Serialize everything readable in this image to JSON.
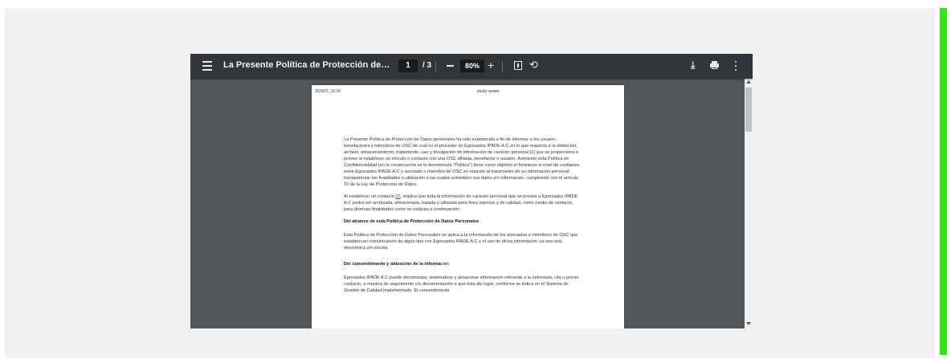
{
  "toolbar": {
    "menu_icon": "hamburger-menu-icon",
    "title": "La Presente Política de Protección de Datos person...",
    "current_page": "1",
    "page_total": "/  3",
    "zoom": "80%",
    "zoom_minus": "—",
    "zoom_plus": "+",
    "rotate_glyph": "⟲",
    "download_glyph": "⤓"
  },
  "page_header": {
    "left": "15/9/22, 10:39",
    "center": "study viewer"
  },
  "document": {
    "p1": "La Presente Política de Protección de Datos personales ha sido establecida a fin de informar a los usuario, benefactores y miembros de OSC de cuál es el proceder de Egresados IPADE A.C en lo que respecta a la obtención, archivo, almacenamiento, tratamiento, uso y divulgación de información de carácter personal [1] que se proporciona o provee al establecer un vínculo o contacto con una OSC afiliada, benefactor o usuario. Asimismo esta Política de Confidencialidad (en lo consecuente se le denominará “Política”) tiene como objetivo el fortalecer el nivel de confianza entre Egresados IPADE A.C y asociado o miembro de OSC en relación al tratamiento de su información personal; transparentar las finalidades o utilización a las cuales sometidos sus datos y/o información, cumpliendo con el artículo 15 de la Ley de Protección de Datos.",
    "p2_before": "Al establecer un contacto ",
    "p2_link": "[2]",
    "p2_after": ", implica que toda la información de carácter personal que se provea a Egresados IPADE A.C podrá ser archivada, almacenada, tratada y utilizada para fines internos y de calidad, como medio de contacto, para diversas finalidades como se estipula a continuación:",
    "h1": "Del alcance de esta Política de Protección de Datos Personales",
    "p3": "Esta Política de Protección de Datos Personales se aplica a la información de los asociados o miembros de OSC que establezcan comunicación de algún tipo con Egresados IPADE A.C y el uso de dicha información; ya sea oral, electrónica y/o escrita.",
    "h2_bold": "Del consentimiento y obtención de la informa",
    "h2_light": "ción",
    "p4": "Egresados IPADE A.C puede documentar, sistematizar y almacenar información referente a la entrevista, cita o primer contacto, a manera de seguimiento y/o documentación a que ésta dio lugar, conforme se indica en el Sistema de Gestión de Calidad implementado. El consentimiento"
  }
}
